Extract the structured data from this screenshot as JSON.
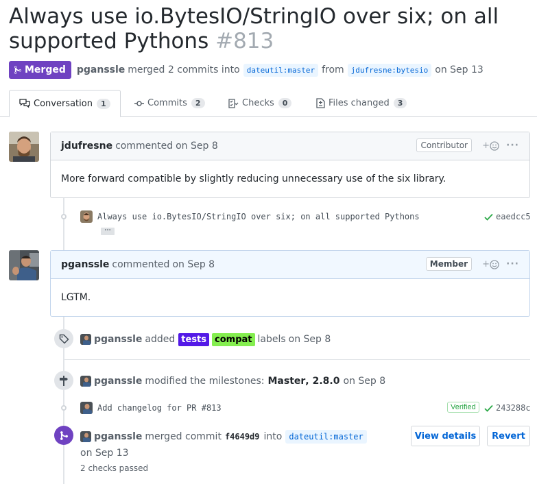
{
  "pr": {
    "title": "Always use io.BytesIO/StringIO over six; on all supported Pythons",
    "number": "#813",
    "state": "Merged",
    "merged_by": "pganssle",
    "merged_text": "merged 2 commits into",
    "base_branch": "dateutil:master",
    "from_text": "from",
    "head_branch": "jdufresne:bytesio",
    "merged_date": "on Sep 13"
  },
  "tabs": [
    {
      "label": "Conversation",
      "count": "1"
    },
    {
      "label": "Commits",
      "count": "2"
    },
    {
      "label": "Checks",
      "count": "0"
    },
    {
      "label": "Files changed",
      "count": "3"
    }
  ],
  "comments": [
    {
      "author": "jdufresne",
      "action": "commented",
      "date": "on Sep 8",
      "role": "Contributor",
      "body": "More forward compatible by slightly reducing unnecessary use of the six library."
    },
    {
      "author": "pganssle",
      "action": "commented",
      "date": "on Sep 8",
      "role": "Member",
      "body": "LGTM."
    }
  ],
  "commit1": {
    "message": "Always use io.BytesIO/StringIO over six; on all supported Pythons",
    "sha": "eaedcc5",
    "ellipsis": "…"
  },
  "label_event": {
    "user": "pganssle",
    "action": "added",
    "labels": [
      {
        "name": "tests",
        "color": "#5319e7",
        "text_color": "#ffffff"
      },
      {
        "name": "compat",
        "color": "#84ee4f",
        "text_color": "#000000"
      }
    ],
    "suffix": "labels",
    "date": "on Sep 8"
  },
  "milestone_event": {
    "user": "pganssle",
    "action": "modified the milestones:",
    "m1": "Master",
    "sep": ",",
    "m2": "2.8.0",
    "date": "on Sep 8"
  },
  "commit2": {
    "message": "Add changelog for PR #813",
    "verified": "Verified",
    "sha": "243288c"
  },
  "merge_event": {
    "user": "pganssle",
    "action": "merged commit",
    "sha": "f4649d9",
    "into": "into",
    "branch": "dateutil:master",
    "date": "on Sep 13",
    "checks": "2 checks passed",
    "view_details": "View details",
    "revert": "Revert"
  },
  "colors": {
    "merged": "#6f42c1",
    "link": "#0366d6",
    "success": "#28a745"
  }
}
